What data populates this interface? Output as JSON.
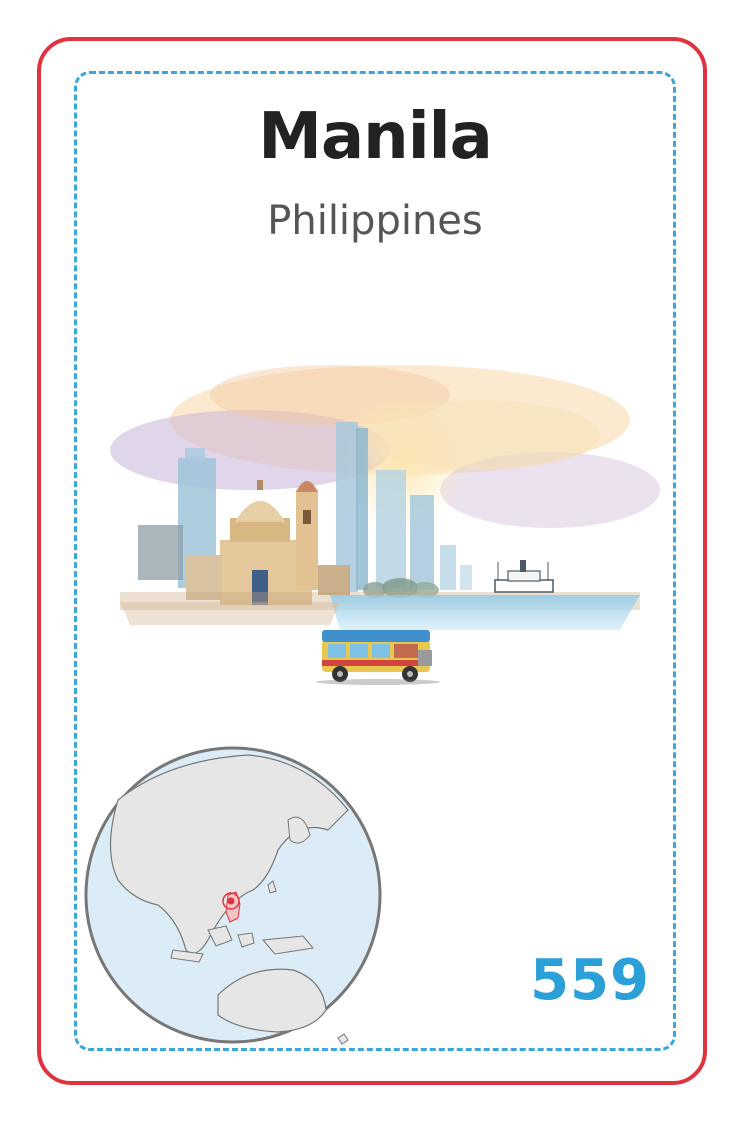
{
  "card": {
    "city": "Manila",
    "country": "Philippines",
    "number": "559"
  },
  "colors": {
    "border": "#e0323f",
    "dashed_border": "#3aa6dd",
    "number": "#2a9fd8",
    "title": "#222222",
    "subtitle": "#555555",
    "ocean": "#dcecf7",
    "land": "#e6e6e6",
    "highlight": "#e0323f"
  },
  "icons": {
    "illustration": "manila-skyline-watercolor",
    "globe": "globe-map-icon",
    "marker": "location-marker-icon"
  }
}
